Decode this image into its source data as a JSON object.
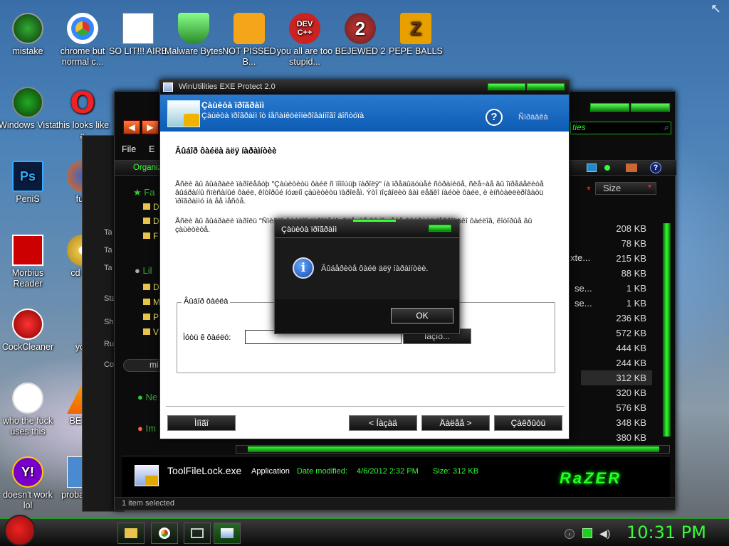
{
  "desktop": {
    "icons": [
      {
        "label": "mistake",
        "icon": "circle-arrow-icon"
      },
      {
        "label": "chrome but normal c...",
        "icon": "chrome-icon"
      },
      {
        "label": "SO LIT!!! AIRE",
        "icon": "cards-icon"
      },
      {
        "label": "Malware Bytes",
        "icon": "shield-check-icon"
      },
      {
        "label": "NOT PISSED B...",
        "icon": "bad-piggies-icon"
      },
      {
        "label": "you all are too stupid...",
        "icon": "devcpp-icon",
        "icon_text": "DEV C++"
      },
      {
        "label": "BEJEWED 2",
        "icon": "bejeweled-icon",
        "icon_text": "2"
      },
      {
        "label": "PEPE BALLS",
        "icon": "zuma-icon",
        "icon_text": "Z"
      },
      {
        "label": "Windows Vista",
        "icon": "recycle-icon"
      },
      {
        "label": "this looks like a",
        "icon": "opera-icon",
        "icon_text": "O"
      },
      {
        "label": "PeniS",
        "icon": "photoshop-icon",
        "icon_text": "Ps"
      },
      {
        "label": "furr",
        "icon": "firefox-icon"
      },
      {
        "label": "Morbius Reader",
        "icon": "pdf-icon"
      },
      {
        "label": "cd gol",
        "icon": "cd-icon"
      },
      {
        "label": "CockCleaner",
        "icon": "ccleaner-icon"
      },
      {
        "label": "you",
        "icon": "star-icon"
      },
      {
        "label": "who the fuck uses this",
        "icon": "flash-icon"
      },
      {
        "label": "BE BE",
        "icon": "vlc-icon"
      },
      {
        "label": "doesn't work lol",
        "icon": "yahoo-icon",
        "icon_text": "Y!"
      },
      {
        "label": "probal a ro",
        "icon": "document-icon"
      }
    ]
  },
  "explorer_back": {
    "menu": [
      "File",
      "E"
    ],
    "organize": "Organiz",
    "favorites_short": "Fa",
    "libraries_short": "Lil",
    "network_short": "Ne",
    "sidebar_left": [
      "Ta",
      "Ta",
      "Ta",
      "Sta",
      "Sh",
      "Ru",
      "Co"
    ],
    "sidebar_letters": [
      "D",
      "D",
      "F",
      "D",
      "M",
      "P",
      "V"
    ],
    "mi_label": "mi",
    "im_label": "Im",
    "size_header": "Size",
    "search_text": "ties",
    "sizes": [
      "208 KB",
      "78 KB",
      "215 KB",
      "88 KB",
      "1 KB",
      "1 KB",
      "236 KB",
      "572 KB",
      "444 KB",
      "244 KB",
      "312 KB",
      "320 KB",
      "576 KB",
      "348 KB",
      "380 KB"
    ],
    "partial": [
      "xte...",
      "se...",
      "se..."
    ],
    "details": {
      "filename": "ToolFileLock.exe",
      "type": "Application",
      "date_label": "Date modified:",
      "date": "4/6/2012 2:32 PM",
      "size_label": "Size:",
      "size": "312 KB"
    },
    "status": "1 item selected",
    "brand": "RaZER"
  },
  "protect": {
    "title": "WinUtilities EXE Protect 2.0",
    "header_title": "Çàùèòà ïðîãðàìì",
    "header_subtitle": "Çàùèòà ïðîãðàìì îò íåñàíêöèîíèðîâàííîãî äîñòóïà",
    "help_link": "Ñïðàâêà",
    "section_title": "Âûáîð ôàéëà äëÿ íàðàìíòèè",
    "para1": "Åñëè âû âûáðàëè ïàðîëåâóþ \"Çàùèòèòü ôàéë ñ ïîìîùüþ ïàðîëÿ\" íà ïðåäûäóùåé ñòðàíèöå, ñëå÷àå âû îïðåäåëèòå âûáðàííû ñïèñàíûé ôàéë, êîòîðûé íóæíî çàùèòèòü ïàðîëåì. Ýòî ïîçâîëèò âàì ëåãêî íàéòè ôàéë, è èíñòàëëèðîâàòü ïðîãðàììó íà åå ìåñòå.",
    "para2": "Åñëè âû âûáðàëè ïàðîëü \"Ñïèñîê ôàéëîâ ïàðîëåé\", ñëå÷àå âû ìîæåòå âûáðàòü íåñêîëüêî ôàéëîâ, êîòîðûå âû çàùèòèòå.",
    "group_label": "Âûáîð ôàéëà",
    "path_label": "Ïóòü ê ôàéëó:",
    "path_value": "",
    "browse_label": "Îáçîð...",
    "btn_cancel": "Ìíîãî",
    "btn_back": "< Íàçàä",
    "btn_next": "Äàëåå >",
    "btn_finish": "Çàêðûòü"
  },
  "msgbox": {
    "title": "Çàùèòà ïðîãðàìì",
    "message": "Âûáåðèòå ôàéë äëÿ íàðàìíòèè.",
    "ok": "OK"
  },
  "taskbar": {
    "clock": "10:31 PM"
  },
  "colors": {
    "accent_green": "#22d422",
    "vista_blue": "#1a6fc0",
    "razer_green": "#2aff2a"
  }
}
